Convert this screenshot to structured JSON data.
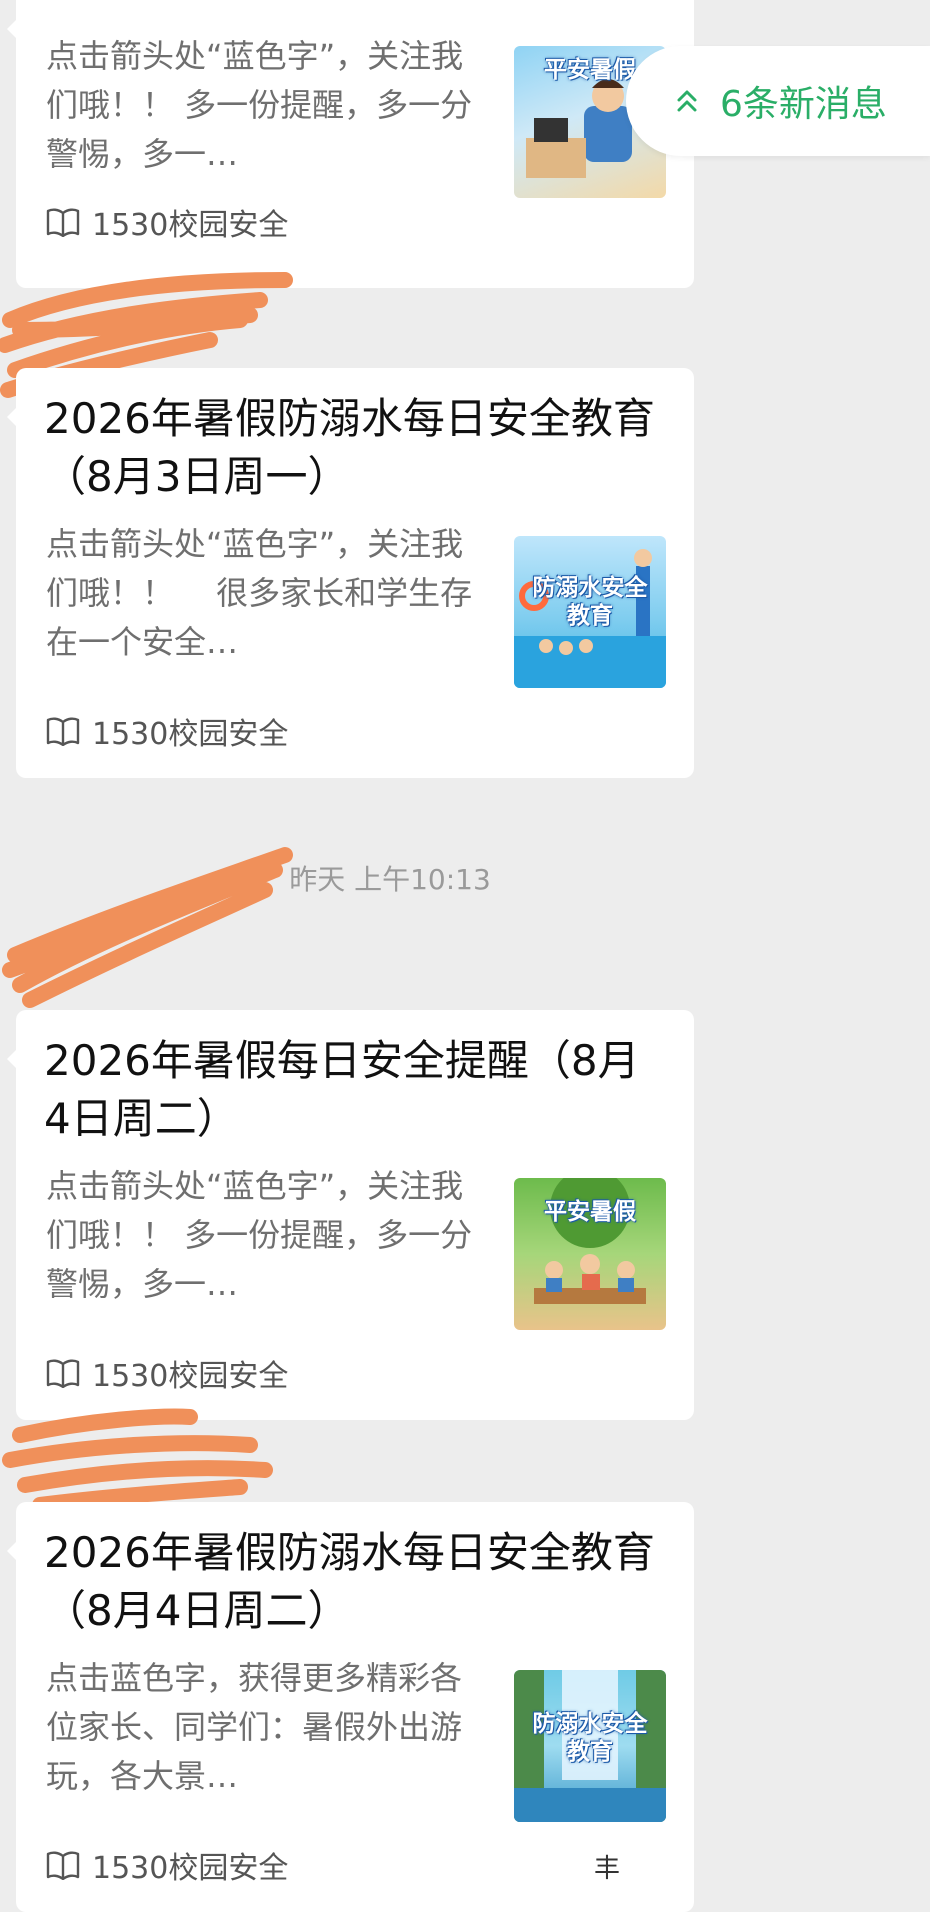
{
  "new_messages": {
    "label": "6条新消息",
    "icon": "double-chevron-up-icon"
  },
  "timestamp": "昨天 上午10:13",
  "source_name": "1530校园安全",
  "cards": [
    {
      "title_tail": "月3日周一）",
      "desc": "点击箭头处“蓝色字”，关注我们哦！！ 多一份提醒，多一分警惕，多一…",
      "thumb_label": "平安暑假",
      "source": "1530校园安全"
    },
    {
      "title": "2026年暑假防溺水每日安全教育（8月3日周一）",
      "desc": "点击箭头处“蓝色字”，关注我们哦！！　 很多家长和学生存在一个安全…",
      "thumb_label": "防溺水安全教育",
      "source": "1530校园安全"
    },
    {
      "title": "2026年暑假每日安全提醒（8月4日周二）",
      "desc": "点击箭头处“蓝色字”，关注我们哦！！ 多一份提醒，多一分警惕，多一…",
      "thumb_label": "平安暑假",
      "source": "1530校园安全"
    },
    {
      "title": "2026年暑假防溺水每日安全教育（8月4日周二）",
      "desc": "点击蓝色字，获得更多精彩各位家长、同学们：暑假外出游玩，各大景…",
      "thumb_label": "防溺水安全教育",
      "source": "1530校园安全"
    }
  ],
  "stray_text": "丰",
  "colors": {
    "background": "#ededed",
    "card": "#ffffff",
    "accent_green": "#2aae67",
    "redaction": "#f0905a"
  }
}
